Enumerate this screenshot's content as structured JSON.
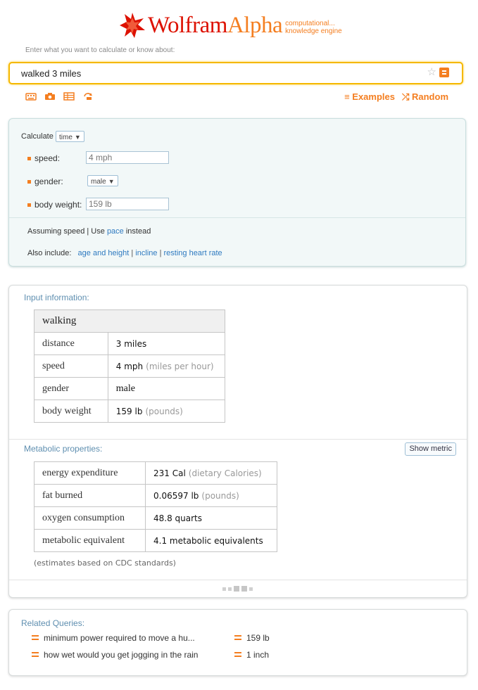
{
  "header": {
    "logo_wolfram": "Wolfram",
    "logo_alpha": "Alpha",
    "tagline_line1": "computational...",
    "tagline_line2": "knowledge engine",
    "prompt": "Enter what you want to calculate or know about:",
    "query": "walked 3 miles",
    "examples_label": "Examples",
    "random_label": "Random",
    "accent_color": "#f47e20",
    "tool_icons": [
      "keyboard-icon",
      "camera-icon",
      "table-icon",
      "upload-icon"
    ]
  },
  "calculator": {
    "calculate_label": "Calculate",
    "calculate_value": "time",
    "fields": [
      {
        "label": "speed:",
        "value": "4 mph"
      },
      {
        "label": "gender:",
        "value": "male"
      },
      {
        "label": "body weight:",
        "value": "159 lb"
      }
    ],
    "assuming_text": "Assuming speed",
    "use_text": "| Use",
    "pace_link": "pace",
    "instead_text": "instead",
    "also_include": "Also include:",
    "include_links": [
      "age and height",
      "incline",
      "resting heart rate"
    ]
  },
  "input_info": {
    "title": "Input information:",
    "header": "walking",
    "rows": [
      {
        "label": "distance",
        "value": "3 miles",
        "unit": ""
      },
      {
        "label": "speed",
        "value": "4 mph",
        "unit": "(miles per hour)"
      },
      {
        "label": "gender",
        "value": "male",
        "unit": ""
      },
      {
        "label": "body weight",
        "value": "159 lb",
        "unit": "(pounds)"
      }
    ]
  },
  "metabolic": {
    "title": "Metabolic properties:",
    "show_metric": "Show metric",
    "rows": [
      {
        "label": "energy expenditure",
        "value": "231 Cal",
        "unit": "(dietary Calories)"
      },
      {
        "label": "fat burned",
        "value": "0.06597 lb",
        "unit": "(pounds)"
      },
      {
        "label": "oxygen consumption",
        "value": "48.8 quarts",
        "unit": ""
      },
      {
        "label": "metabolic equivalent",
        "value": "4.1 metabolic equivalents",
        "unit": ""
      }
    ],
    "note": "(estimates based on CDC standards)"
  },
  "related": {
    "title": "Related Queries:",
    "items": [
      "minimum power required to move a hu...",
      "159 lb",
      "how wet would you get jogging in the rain",
      "1 inch"
    ]
  }
}
